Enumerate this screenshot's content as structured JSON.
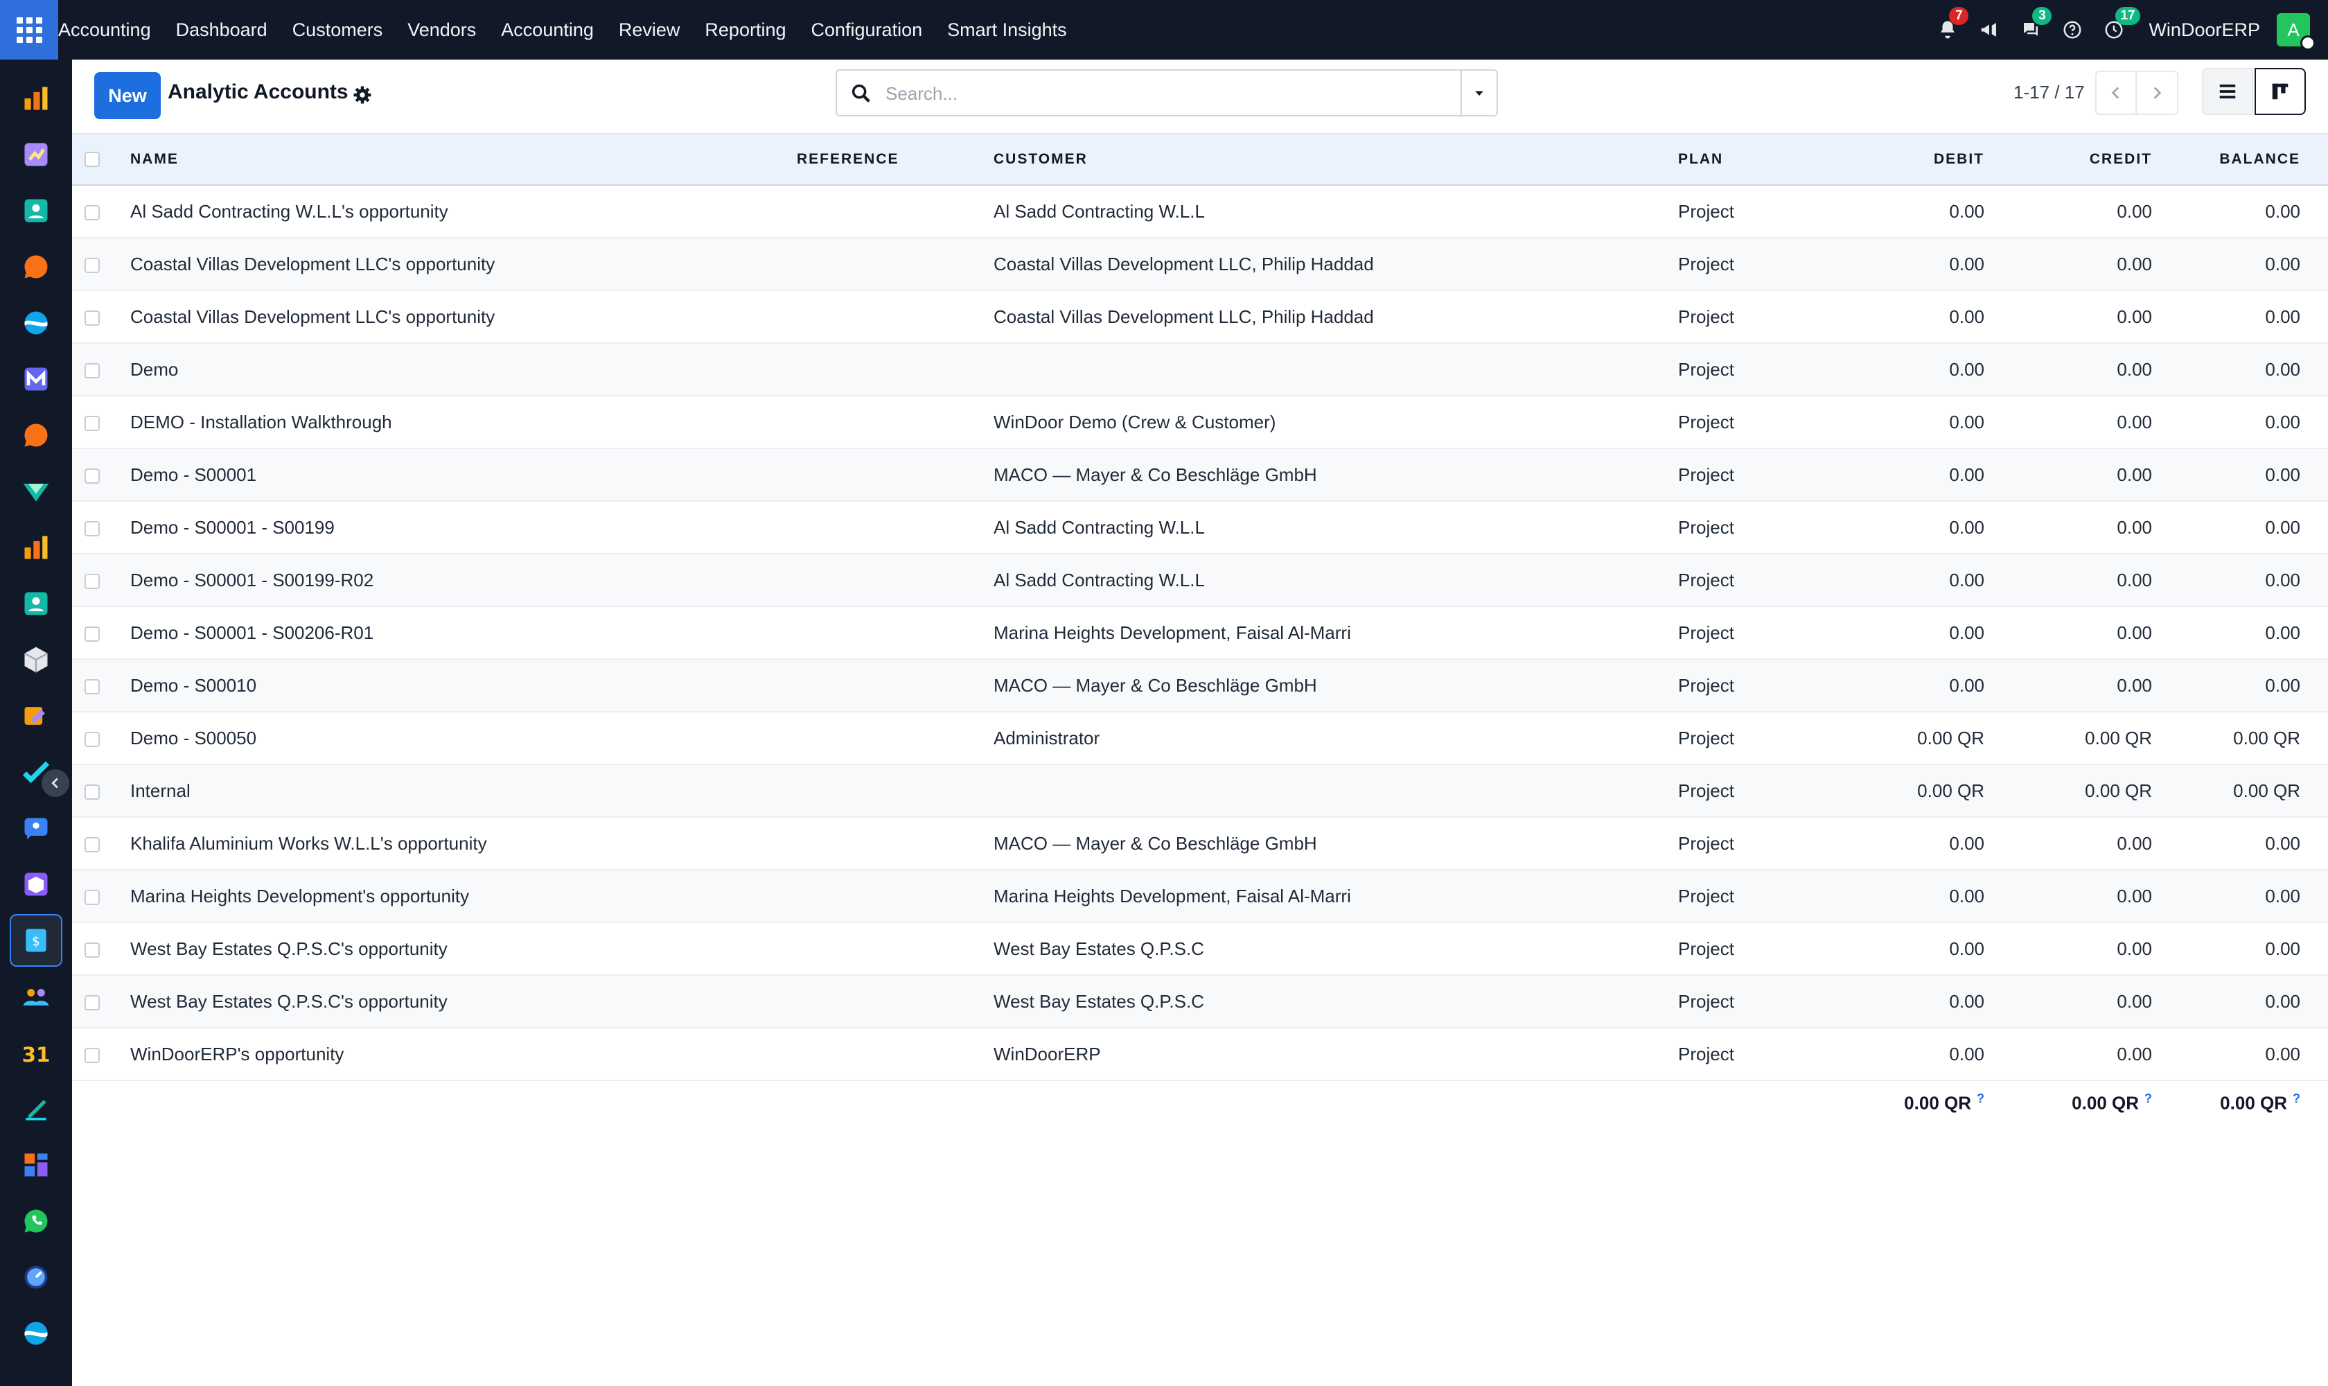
{
  "topbar": {
    "app_name": "Accounting",
    "menu": [
      "Dashboard",
      "Customers",
      "Vendors",
      "Accounting",
      "Review",
      "Reporting",
      "Configuration",
      "Smart Insights"
    ],
    "notifications_count": "7",
    "messages_count": "3",
    "activities_count": "17",
    "company": "WinDoorERP",
    "avatar_letter": "A"
  },
  "control": {
    "new_label": "New",
    "title": "Analytic Accounts",
    "search_placeholder": "Search...",
    "pager": "1-17 / 17"
  },
  "table": {
    "headers": {
      "name": "NAME",
      "reference": "REFERENCE",
      "customer": "CUSTOMER",
      "plan": "PLAN",
      "debit": "DEBIT",
      "credit": "CREDIT",
      "balance": "BALANCE"
    },
    "rows": [
      {
        "name": "Al Sadd Contracting W.L.L's opportunity",
        "reference": "",
        "customer": "Al Sadd Contracting W.L.L",
        "plan": "Project",
        "debit": "0.00",
        "credit": "0.00",
        "balance": "0.00"
      },
      {
        "name": "Coastal Villas Development LLC's opportunity",
        "reference": "",
        "customer": "Coastal Villas Development LLC, Philip Haddad",
        "plan": "Project",
        "debit": "0.00",
        "credit": "0.00",
        "balance": "0.00"
      },
      {
        "name": "Coastal Villas Development LLC's opportunity",
        "reference": "",
        "customer": "Coastal Villas Development LLC, Philip Haddad",
        "plan": "Project",
        "debit": "0.00",
        "credit": "0.00",
        "balance": "0.00"
      },
      {
        "name": "Demo",
        "reference": "",
        "customer": "",
        "plan": "Project",
        "debit": "0.00",
        "credit": "0.00",
        "balance": "0.00"
      },
      {
        "name": "DEMO - Installation Walkthrough",
        "reference": "",
        "customer": "WinDoor Demo (Crew & Customer)",
        "plan": "Project",
        "debit": "0.00",
        "credit": "0.00",
        "balance": "0.00"
      },
      {
        "name": "Demo - S00001",
        "reference": "",
        "customer": "MACO — Mayer & Co Beschläge GmbH",
        "plan": "Project",
        "debit": "0.00",
        "credit": "0.00",
        "balance": "0.00"
      },
      {
        "name": "Demo - S00001 - S00199",
        "reference": "",
        "customer": "Al Sadd Contracting W.L.L",
        "plan": "Project",
        "debit": "0.00",
        "credit": "0.00",
        "balance": "0.00"
      },
      {
        "name": "Demo - S00001 - S00199-R02",
        "reference": "",
        "customer": "Al Sadd Contracting W.L.L",
        "plan": "Project",
        "debit": "0.00",
        "credit": "0.00",
        "balance": "0.00"
      },
      {
        "name": "Demo - S00001 - S00206-R01",
        "reference": "",
        "customer": "Marina Heights Development, Faisal Al-Marri",
        "plan": "Project",
        "debit": "0.00",
        "credit": "0.00",
        "balance": "0.00"
      },
      {
        "name": "Demo - S00010",
        "reference": "",
        "customer": "MACO — Mayer & Co Beschläge GmbH",
        "plan": "Project",
        "debit": "0.00",
        "credit": "0.00",
        "balance": "0.00"
      },
      {
        "name": "Demo - S00050",
        "reference": "",
        "customer": "Administrator",
        "plan": "Project",
        "debit": "0.00 QR",
        "credit": "0.00 QR",
        "balance": "0.00 QR"
      },
      {
        "name": "Internal",
        "reference": "",
        "customer": "",
        "plan": "Project",
        "debit": "0.00 QR",
        "credit": "0.00 QR",
        "balance": "0.00 QR"
      },
      {
        "name": "Khalifa Aluminium Works W.L.L's opportunity",
        "reference": "",
        "customer": "MACO — Mayer & Co Beschläge GmbH",
        "plan": "Project",
        "debit": "0.00",
        "credit": "0.00",
        "balance": "0.00"
      },
      {
        "name": "Marina Heights Development's opportunity",
        "reference": "",
        "customer": "Marina Heights Development, Faisal Al-Marri",
        "plan": "Project",
        "debit": "0.00",
        "credit": "0.00",
        "balance": "0.00"
      },
      {
        "name": "West Bay Estates Q.P.S.C's opportunity",
        "reference": "",
        "customer": "West Bay Estates Q.P.S.C",
        "plan": "Project",
        "debit": "0.00",
        "credit": "0.00",
        "balance": "0.00"
      },
      {
        "name": "West Bay Estates Q.P.S.C's opportunity",
        "reference": "",
        "customer": "West Bay Estates Q.P.S.C",
        "plan": "Project",
        "debit": "0.00",
        "credit": "0.00",
        "balance": "0.00"
      },
      {
        "name": "WinDoorERP's opportunity",
        "reference": "",
        "customer": "WinDoorERP",
        "plan": "Project",
        "debit": "0.00",
        "credit": "0.00",
        "balance": "0.00"
      }
    ],
    "totals": {
      "debit": "0.00 QR",
      "credit": "0.00 QR",
      "balance": "0.00 QR",
      "hint": "?"
    }
  },
  "sidebar": {
    "icons": [
      "reporting-icon",
      "sales-icon",
      "contacts-icon",
      "discuss-icon",
      "website-icon",
      "email-marketing-icon",
      "livechat-icon",
      "crm-icon",
      "accounting-chart-icon",
      "employees-icon",
      "inventory-icon",
      "manufacturing-icon",
      "project-icon",
      "helpdesk-icon",
      "purchase-icon",
      "invoicing-icon",
      "team-icon",
      "calendar-icon",
      "sign-icon",
      "dashboards-icon",
      "whatsapp-icon",
      "timesheet-icon",
      "website-builder-icon"
    ],
    "calendar_day": "31",
    "active_index": 15
  },
  "colors": {
    "topbar_bg": "#111827",
    "primary": "#1d6fe0",
    "header_row_bg": "#eaf2fd"
  }
}
